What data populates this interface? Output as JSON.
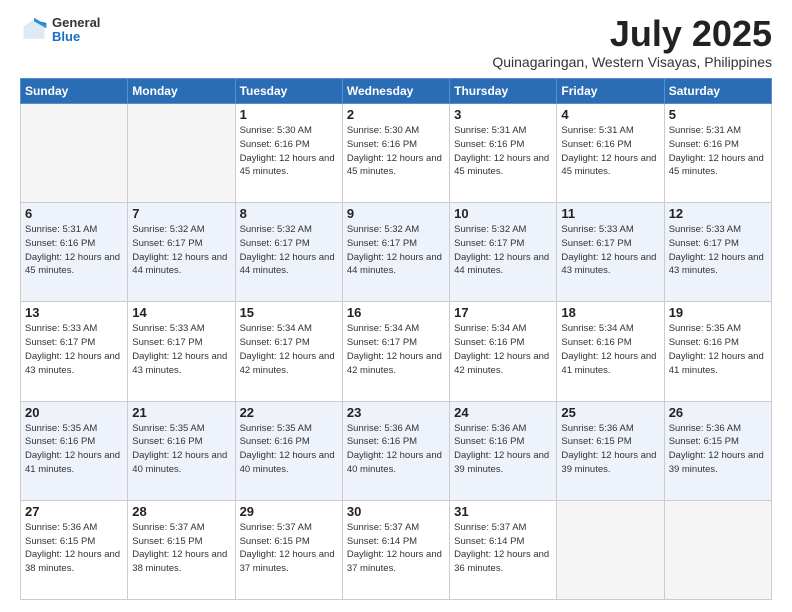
{
  "header": {
    "logo_general": "General",
    "logo_blue": "Blue",
    "title": "July 2025",
    "location": "Quinagaringan, Western Visayas, Philippines"
  },
  "weekdays": [
    "Sunday",
    "Monday",
    "Tuesday",
    "Wednesday",
    "Thursday",
    "Friday",
    "Saturday"
  ],
  "weeks": [
    [
      {
        "day": "",
        "info": ""
      },
      {
        "day": "",
        "info": ""
      },
      {
        "day": "1",
        "info": "Sunrise: 5:30 AM\nSunset: 6:16 PM\nDaylight: 12 hours and 45 minutes."
      },
      {
        "day": "2",
        "info": "Sunrise: 5:30 AM\nSunset: 6:16 PM\nDaylight: 12 hours and 45 minutes."
      },
      {
        "day": "3",
        "info": "Sunrise: 5:31 AM\nSunset: 6:16 PM\nDaylight: 12 hours and 45 minutes."
      },
      {
        "day": "4",
        "info": "Sunrise: 5:31 AM\nSunset: 6:16 PM\nDaylight: 12 hours and 45 minutes."
      },
      {
        "day": "5",
        "info": "Sunrise: 5:31 AM\nSunset: 6:16 PM\nDaylight: 12 hours and 45 minutes."
      }
    ],
    [
      {
        "day": "6",
        "info": "Sunrise: 5:31 AM\nSunset: 6:16 PM\nDaylight: 12 hours and 45 minutes."
      },
      {
        "day": "7",
        "info": "Sunrise: 5:32 AM\nSunset: 6:17 PM\nDaylight: 12 hours and 44 minutes."
      },
      {
        "day": "8",
        "info": "Sunrise: 5:32 AM\nSunset: 6:17 PM\nDaylight: 12 hours and 44 minutes."
      },
      {
        "day": "9",
        "info": "Sunrise: 5:32 AM\nSunset: 6:17 PM\nDaylight: 12 hours and 44 minutes."
      },
      {
        "day": "10",
        "info": "Sunrise: 5:32 AM\nSunset: 6:17 PM\nDaylight: 12 hours and 44 minutes."
      },
      {
        "day": "11",
        "info": "Sunrise: 5:33 AM\nSunset: 6:17 PM\nDaylight: 12 hours and 43 minutes."
      },
      {
        "day": "12",
        "info": "Sunrise: 5:33 AM\nSunset: 6:17 PM\nDaylight: 12 hours and 43 minutes."
      }
    ],
    [
      {
        "day": "13",
        "info": "Sunrise: 5:33 AM\nSunset: 6:17 PM\nDaylight: 12 hours and 43 minutes."
      },
      {
        "day": "14",
        "info": "Sunrise: 5:33 AM\nSunset: 6:17 PM\nDaylight: 12 hours and 43 minutes."
      },
      {
        "day": "15",
        "info": "Sunrise: 5:34 AM\nSunset: 6:17 PM\nDaylight: 12 hours and 42 minutes."
      },
      {
        "day": "16",
        "info": "Sunrise: 5:34 AM\nSunset: 6:17 PM\nDaylight: 12 hours and 42 minutes."
      },
      {
        "day": "17",
        "info": "Sunrise: 5:34 AM\nSunset: 6:16 PM\nDaylight: 12 hours and 42 minutes."
      },
      {
        "day": "18",
        "info": "Sunrise: 5:34 AM\nSunset: 6:16 PM\nDaylight: 12 hours and 41 minutes."
      },
      {
        "day": "19",
        "info": "Sunrise: 5:35 AM\nSunset: 6:16 PM\nDaylight: 12 hours and 41 minutes."
      }
    ],
    [
      {
        "day": "20",
        "info": "Sunrise: 5:35 AM\nSunset: 6:16 PM\nDaylight: 12 hours and 41 minutes."
      },
      {
        "day": "21",
        "info": "Sunrise: 5:35 AM\nSunset: 6:16 PM\nDaylight: 12 hours and 40 minutes."
      },
      {
        "day": "22",
        "info": "Sunrise: 5:35 AM\nSunset: 6:16 PM\nDaylight: 12 hours and 40 minutes."
      },
      {
        "day": "23",
        "info": "Sunrise: 5:36 AM\nSunset: 6:16 PM\nDaylight: 12 hours and 40 minutes."
      },
      {
        "day": "24",
        "info": "Sunrise: 5:36 AM\nSunset: 6:16 PM\nDaylight: 12 hours and 39 minutes."
      },
      {
        "day": "25",
        "info": "Sunrise: 5:36 AM\nSunset: 6:15 PM\nDaylight: 12 hours and 39 minutes."
      },
      {
        "day": "26",
        "info": "Sunrise: 5:36 AM\nSunset: 6:15 PM\nDaylight: 12 hours and 39 minutes."
      }
    ],
    [
      {
        "day": "27",
        "info": "Sunrise: 5:36 AM\nSunset: 6:15 PM\nDaylight: 12 hours and 38 minutes."
      },
      {
        "day": "28",
        "info": "Sunrise: 5:37 AM\nSunset: 6:15 PM\nDaylight: 12 hours and 38 minutes."
      },
      {
        "day": "29",
        "info": "Sunrise: 5:37 AM\nSunset: 6:15 PM\nDaylight: 12 hours and 37 minutes."
      },
      {
        "day": "30",
        "info": "Sunrise: 5:37 AM\nSunset: 6:14 PM\nDaylight: 12 hours and 37 minutes."
      },
      {
        "day": "31",
        "info": "Sunrise: 5:37 AM\nSunset: 6:14 PM\nDaylight: 12 hours and 36 minutes."
      },
      {
        "day": "",
        "info": ""
      },
      {
        "day": "",
        "info": ""
      }
    ]
  ]
}
